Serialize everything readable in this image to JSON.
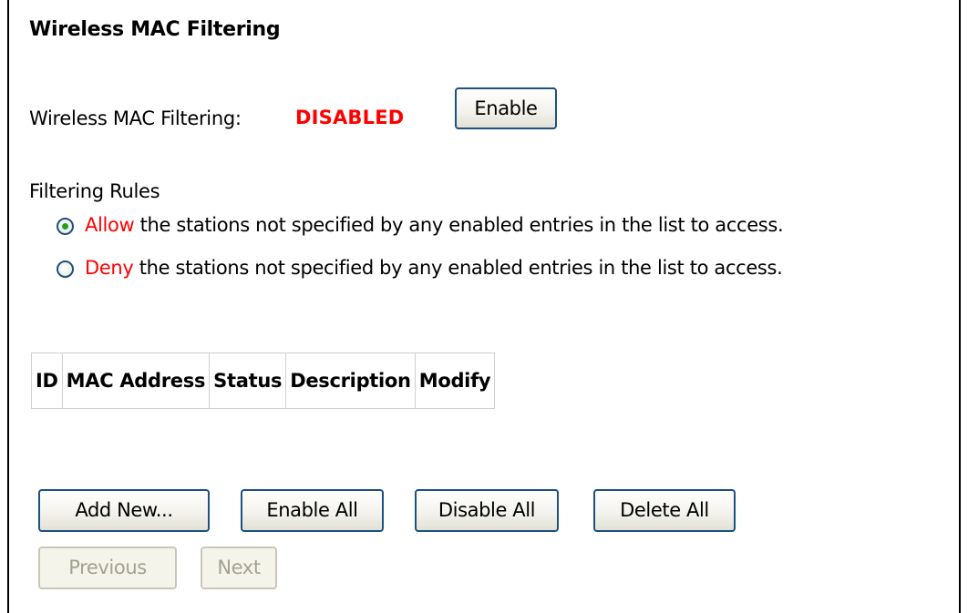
{
  "page": {
    "title": "Wireless MAC Filtering"
  },
  "filtering_status": {
    "label": "Wireless MAC Filtering:",
    "value": "DISABLED",
    "value_color": "#ff0000",
    "enable_button": "Enable"
  },
  "filtering_rules": {
    "heading": "Filtering Rules",
    "options": [
      {
        "keyword": "Allow",
        "text": " the stations not specified by any enabled entries in the list to access.",
        "selected": true
      },
      {
        "keyword": "Deny",
        "text": " the stations not specified by any enabled entries in the list to access.",
        "selected": false
      }
    ]
  },
  "table": {
    "columns": [
      "ID",
      "MAC Address",
      "Status",
      "Description",
      "Modify"
    ],
    "rows": []
  },
  "actions": {
    "add_new": "Add New...",
    "enable_all": "Enable All",
    "disable_all": "Disable All",
    "delete_all": "Delete All"
  },
  "pagination": {
    "previous": "Previous",
    "next": "Next",
    "previous_enabled": false,
    "next_enabled": false
  },
  "colors": {
    "accent_red": "#ff0000",
    "button_border": "#1c5180",
    "radio_dot": "#21a121"
  }
}
